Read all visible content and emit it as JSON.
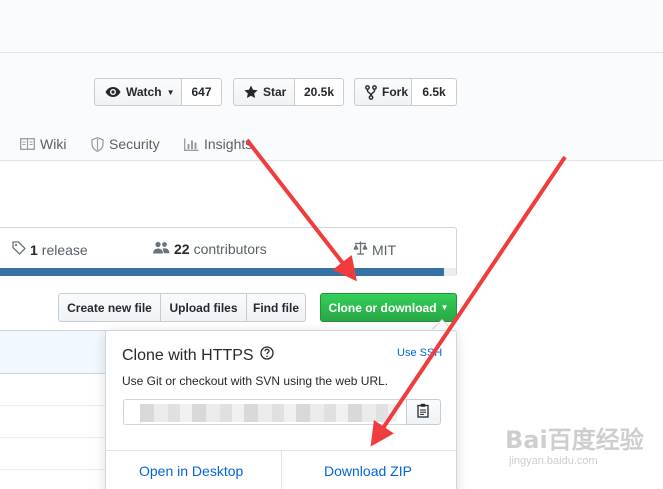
{
  "repo_actions": {
    "watch": {
      "label": "Watch",
      "count": "647"
    },
    "star": {
      "label": "Star",
      "count": "20.5k"
    },
    "fork": {
      "label": "Fork",
      "count": "6.5k"
    }
  },
  "tabs": [
    {
      "label": "Wiki",
      "icon": "book-icon"
    },
    {
      "label": "Security",
      "icon": "shield-icon"
    },
    {
      "label": "Insights",
      "icon": "graph-icon"
    }
  ],
  "summary": {
    "releases_count": "1",
    "releases_label": "release",
    "contributors_count": "22",
    "contributors_label": "contributors",
    "license": "MIT",
    "language_color": "#3572a5"
  },
  "file_actions": {
    "create_label": "Create new file",
    "upload_label": "Upload files",
    "find_label": "Find file",
    "clone_label": "Clone or download"
  },
  "clone_popover": {
    "title": "Clone with HTTPS",
    "use_ssh": "Use SSH",
    "description": "Use Git or checkout with SVN using the web URL.",
    "open_desktop": "Open in Desktop",
    "download_zip": "Download ZIP"
  },
  "watermark": {
    "logo": "Bai百度经验",
    "sub": "jingyan.baidu.com"
  },
  "colors": {
    "primary_green": "#28a745",
    "link_blue": "#0366d6",
    "annotation_red": "#f03c3c"
  }
}
